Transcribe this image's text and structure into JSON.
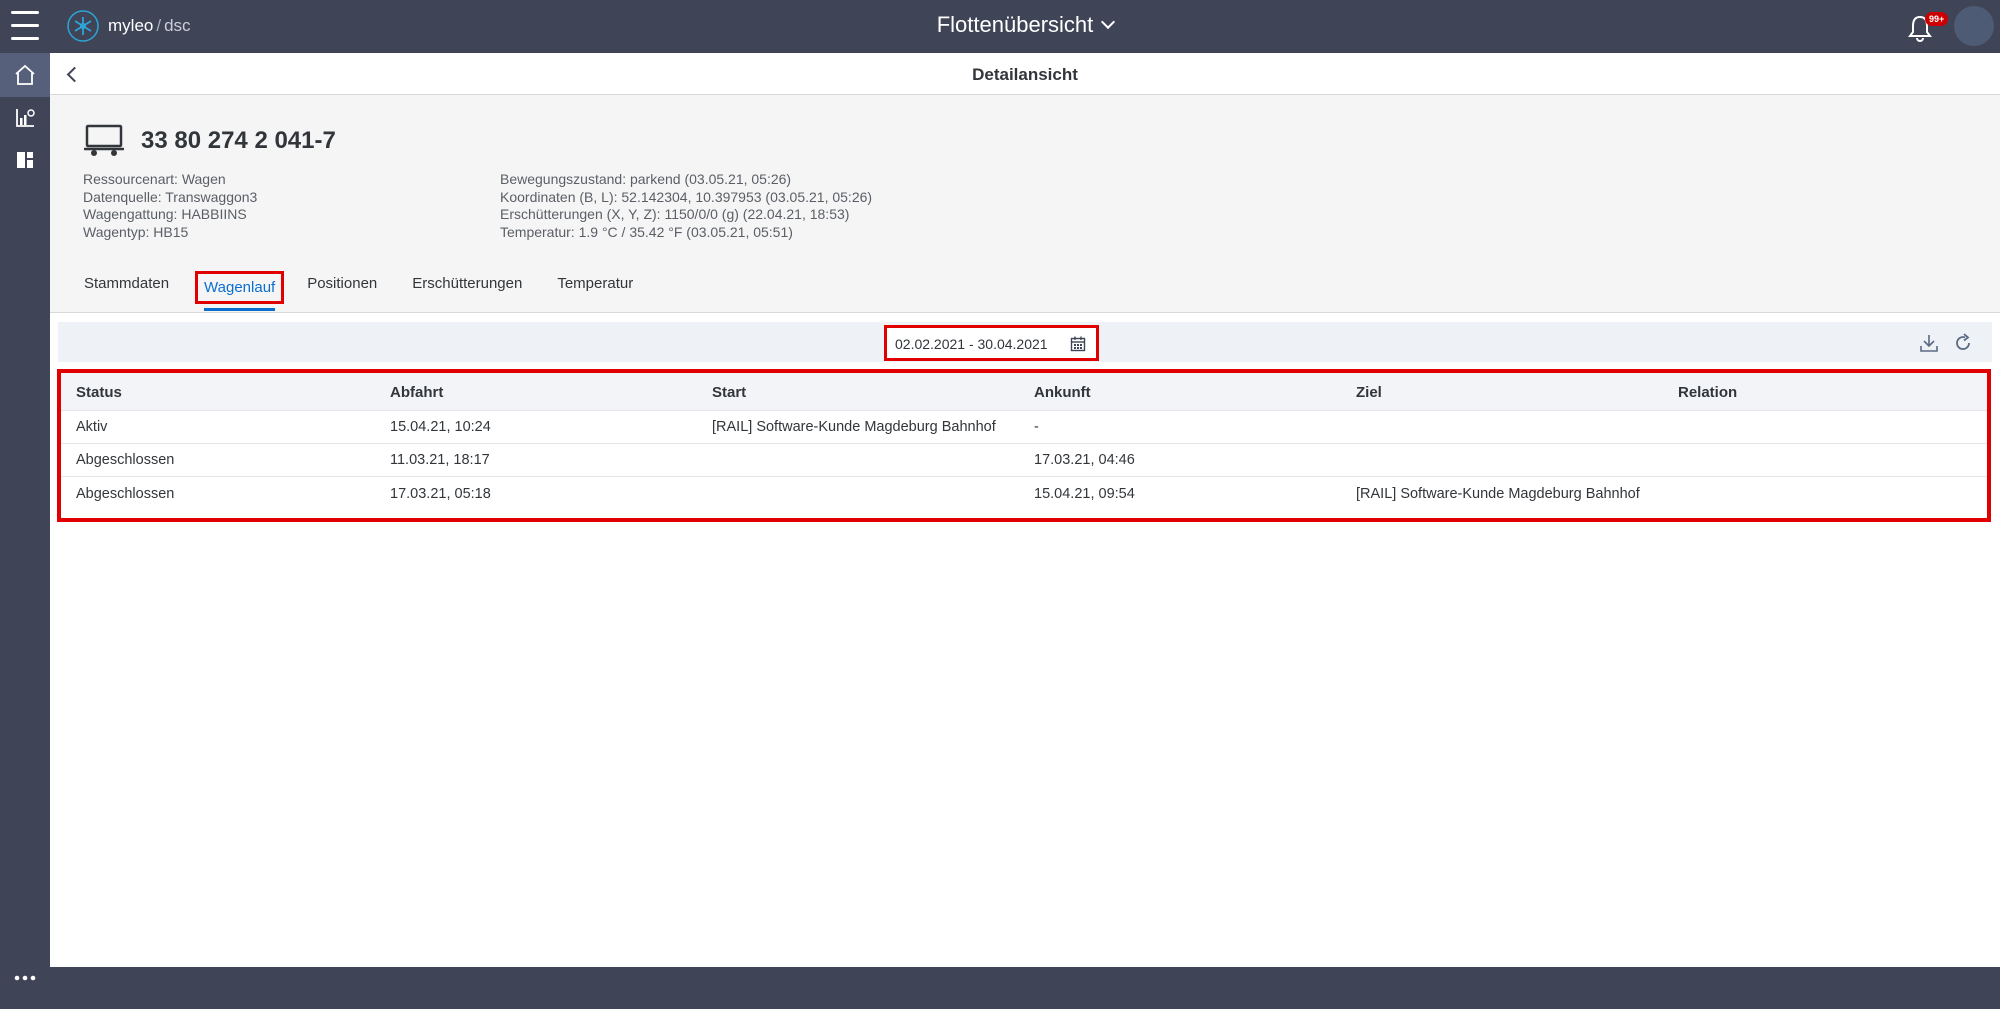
{
  "app": {
    "logo_name": "myleo",
    "logo_slash": "/",
    "logo_suffix": "dsc",
    "title": "Flottenübersicht",
    "notification_badge": "99+"
  },
  "icons": {
    "menu": "hamburger-icon",
    "home": "home-icon",
    "analytics": "chart-icon",
    "dashboard": "dashboard-icon",
    "more": "more-icon",
    "bell": "bell-icon",
    "back": "back-icon",
    "wagon": "wagon-icon",
    "calendar": "calendar-icon",
    "download": "download-icon",
    "refresh": "refresh-icon"
  },
  "subheader": {
    "title": "Detailansicht"
  },
  "object": {
    "title": "33 80 274 2 041-7",
    "attributes_left": [
      "Ressourcenart: Wagen",
      "Datenquelle: Transwaggon3",
      "Wagengattung: HABBIINS",
      "Wagentyp: HB15"
    ],
    "attributes_right": [
      "Bewegungszustand: parkend (03.05.21, 05:26)",
      "Koordinaten (B, L): 52.142304, 10.397953 (03.05.21, 05:26)",
      "Erschütterungen (X, Y, Z): 1150/0/0 (g) (22.04.21, 18:53)",
      "Temperatur: 1.9 °C / 35.42 °F (03.05.21, 05:51)"
    ]
  },
  "tabs": [
    {
      "label": "Stammdaten"
    },
    {
      "label": "Wagenlauf",
      "selected": true
    },
    {
      "label": "Positionen"
    },
    {
      "label": "Erschütterungen"
    },
    {
      "label": "Temperatur"
    }
  ],
  "toolbar": {
    "date_range": "02.02.2021 - 30.04.2021"
  },
  "table": {
    "columns": [
      "Status",
      "Abfahrt",
      "Start",
      "Ankunft",
      "Ziel",
      "Relation"
    ],
    "rows": [
      [
        "Aktiv",
        "15.04.21, 10:24",
        "[RAIL] Software-Kunde Magdeburg Bahnhof",
        "-",
        "",
        ""
      ],
      [
        "Abgeschlossen",
        "11.03.21, 18:17",
        "",
        "17.03.21, 04:46",
        "",
        ""
      ],
      [
        "Abgeschlossen",
        "17.03.21, 05:18",
        "",
        "15.04.21, 09:54",
        "[RAIL] Software-Kunde Magdeburg Bahnhof",
        ""
      ]
    ]
  },
  "colors": {
    "shell": "#3f4557",
    "accent": "#0a6ed1",
    "highlight": "#e00000"
  }
}
